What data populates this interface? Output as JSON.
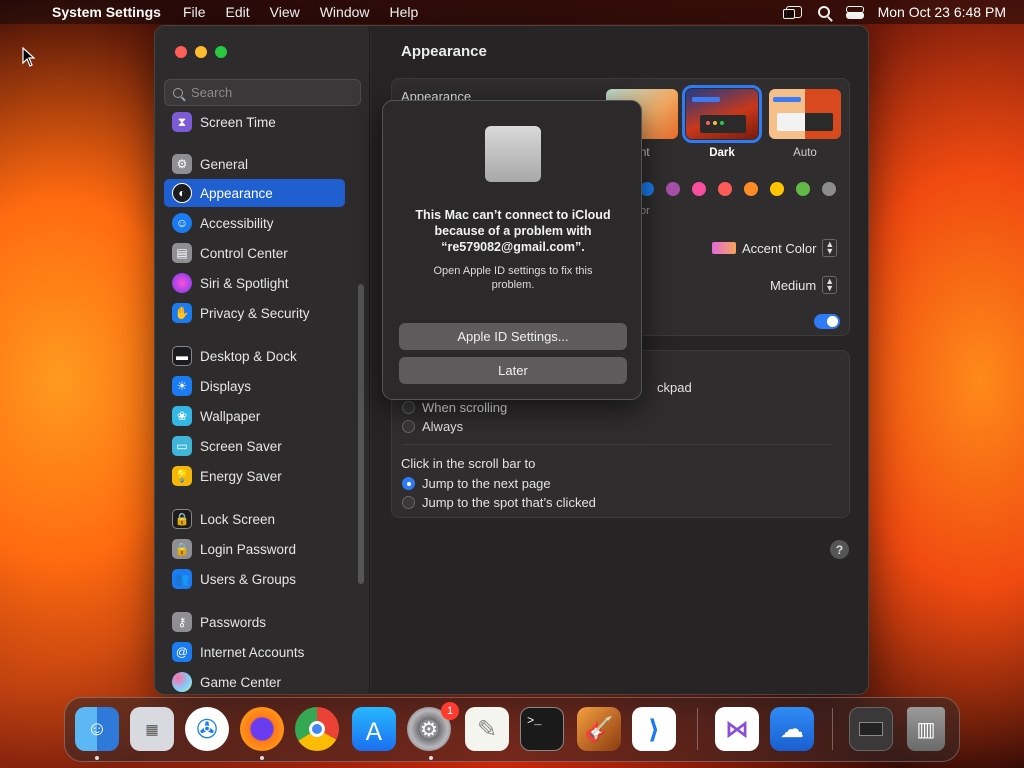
{
  "menubar": {
    "app_name": "System Settings",
    "menus": [
      "File",
      "Edit",
      "View",
      "Window",
      "Help"
    ],
    "datetime": "Mon Oct 23  6:48 PM"
  },
  "sidebar": {
    "search_placeholder": "Search",
    "items": [
      {
        "label": "Screen Time",
        "icon": "hourglass-icon",
        "color": "#7b5cd6"
      },
      {
        "label": "General",
        "icon": "gear-icon",
        "color": "#8e8e93"
      },
      {
        "label": "Appearance",
        "icon": "appearance-icon",
        "color": "#1c1c1e"
      },
      {
        "label": "Accessibility",
        "icon": "accessibility-icon",
        "color": "#1a7cf0"
      },
      {
        "label": "Control Center",
        "icon": "control-center-icon",
        "color": "#8e8e93"
      },
      {
        "label": "Siri & Spotlight",
        "icon": "siri-icon",
        "color": "#c23ec9"
      },
      {
        "label": "Privacy & Security",
        "icon": "hand-icon",
        "color": "#1a7cf0"
      },
      {
        "label": "Desktop & Dock",
        "icon": "desktop-icon",
        "color": "#1c1c1e"
      },
      {
        "label": "Displays",
        "icon": "sun-icon",
        "color": "#1a7cf0"
      },
      {
        "label": "Wallpaper",
        "icon": "flower-icon",
        "color": "#35b7e6"
      },
      {
        "label": "Screen Saver",
        "icon": "screensaver-icon",
        "color": "#3fb5d9"
      },
      {
        "label": "Energy Saver",
        "icon": "bulb-icon",
        "color": "#f5b60a"
      },
      {
        "label": "Lock Screen",
        "icon": "lock-icon",
        "color": "#1c1c1e"
      },
      {
        "label": "Login Password",
        "icon": "lock-icon",
        "color": "#8e8e93"
      },
      {
        "label": "Users & Groups",
        "icon": "users-icon",
        "color": "#1a7cf0"
      },
      {
        "label": "Passwords",
        "icon": "key-icon",
        "color": "#8e8e93"
      },
      {
        "label": "Internet Accounts",
        "icon": "at-icon",
        "color": "#1a7cf0"
      },
      {
        "label": "Game Center",
        "icon": "game-center-icon",
        "color": "#ffffff"
      }
    ],
    "active": "Appearance"
  },
  "content": {
    "title": "Appearance",
    "appearance_label": "Appearance",
    "themes": [
      {
        "label": "Light",
        "visible_label": "nt"
      },
      {
        "label": "Dark"
      },
      {
        "label": "Auto"
      }
    ],
    "selected_theme": "Dark",
    "accent_colors": [
      "#1a7cf0",
      "#a550a7",
      "#f74f9e",
      "#fc5b57",
      "#fd8b26",
      "#ffc600",
      "#62ba46",
      "#8c8c8c"
    ],
    "highlight_fragment": "or",
    "highlight_value": "Accent Color",
    "sidebar_icon_size_value": "Medium",
    "scroll_fragment": "ckpad",
    "scroll_options": [
      {
        "label": "When scrolling",
        "selected": false
      },
      {
        "label": "Always",
        "selected": false
      }
    ],
    "click_label": "Click in the scroll bar to",
    "click_options": [
      {
        "label": "Jump to the next page",
        "selected": true
      },
      {
        "label": "Jump to the spot that’s clicked",
        "selected": false
      }
    ],
    "help": "?"
  },
  "alert": {
    "title": "This Mac can’t connect to iCloud because of a problem with “re579082@gmail.com”.",
    "message": "Open Apple ID settings to fix this problem.",
    "primary": "Apple ID Settings...",
    "secondary": "Later"
  },
  "dock": {
    "apps": [
      "Finder",
      "Launchpad",
      "Safari",
      "Firefox",
      "Chrome",
      "App Store",
      "System Settings",
      "TextEdit",
      "Terminal",
      "GarageBand",
      "VS Code",
      "Visual Studio",
      "Weather",
      "Downloads",
      "Trash"
    ],
    "settings_badge": "1"
  }
}
